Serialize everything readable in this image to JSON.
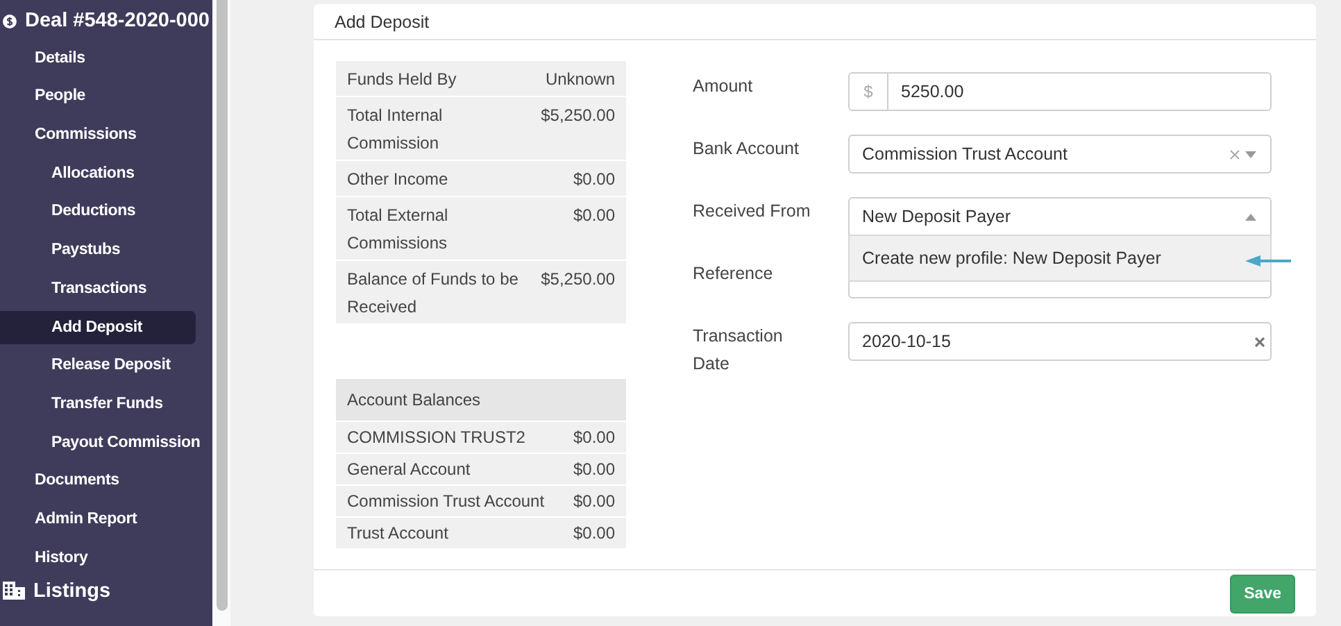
{
  "sidebar": {
    "title": "Deal #548-2020-000",
    "items": [
      {
        "label": "Details",
        "selected": false
      },
      {
        "label": "People",
        "selected": false
      },
      {
        "label": "Commissions",
        "selected": false,
        "children": [
          {
            "label": "Allocations",
            "selected": false
          },
          {
            "label": "Deductions",
            "selected": false
          },
          {
            "label": "Paystubs",
            "selected": false
          },
          {
            "label": "Transactions",
            "selected": false
          },
          {
            "label": "Add Deposit",
            "selected": true
          },
          {
            "label": "Release Deposit",
            "selected": false
          },
          {
            "label": "Transfer Funds",
            "selected": false
          },
          {
            "label": "Payout Commission",
            "selected": false
          }
        ]
      },
      {
        "label": "Documents",
        "selected": false
      },
      {
        "label": "Admin Report",
        "selected": false
      },
      {
        "label": "History",
        "selected": false
      }
    ],
    "section": "Listings"
  },
  "card": {
    "title": "Add Deposit",
    "funds_table": [
      {
        "label": "Funds Held By",
        "value": "Unknown"
      },
      {
        "label": "Total Internal Commission",
        "value": "$5,250.00"
      },
      {
        "label": "Other Income",
        "value": "$0.00"
      },
      {
        "label": "Total External Commissions",
        "value": "$0.00"
      },
      {
        "label": "Balance of Funds to be Received",
        "value": "$5,250.00"
      }
    ],
    "balances_table": {
      "header": "Account Balances",
      "rows": [
        {
          "label": "COMMISSION TRUST2",
          "value": "$0.00"
        },
        {
          "label": "General Account",
          "value": "$0.00"
        },
        {
          "label": "Commission Trust Account",
          "value": "$0.00"
        },
        {
          "label": "Trust Account",
          "value": "$0.00"
        }
      ]
    },
    "fields": [
      {
        "label": "Amount",
        "kind": "prefixed",
        "prefix": "$",
        "value": "5250.00"
      },
      {
        "label": "Bank Account",
        "kind": "select",
        "value": "Commission Trust Account",
        "expanded": false
      },
      {
        "label": "Received From",
        "kind": "combo",
        "value": "New Deposit Payer",
        "expanded": true,
        "options": [
          "Create new profile: New Deposit Payer"
        ]
      },
      {
        "label": "Reference",
        "kind": "text"
      },
      {
        "label": "Transaction Date",
        "kind": "date",
        "value": "2020-10-15"
      }
    ],
    "save_button": "Save"
  }
}
